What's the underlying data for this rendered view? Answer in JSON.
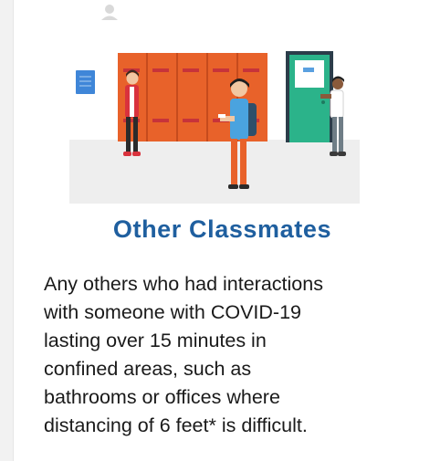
{
  "card": {
    "title": "Other Classmates",
    "description_lines": [
      "Any others who had interactions",
      "with someone with COVID-19",
      "lasting over 15 minutes in",
      "confined areas, such as",
      "bathrooms or offices where",
      "distancing of 6 feet* is difficult."
    ]
  },
  "illustration": {
    "icons": [
      "person-icon",
      "poster-icon",
      "lockers",
      "door",
      "student-left",
      "student-center",
      "student-right"
    ],
    "colors": {
      "locker": "#e8622a",
      "locker_slot": "#c7333a",
      "door": "#2bb38a",
      "floor": "#eeeeee",
      "poster": "#3f86d8",
      "title": "#1f5f9f"
    }
  }
}
